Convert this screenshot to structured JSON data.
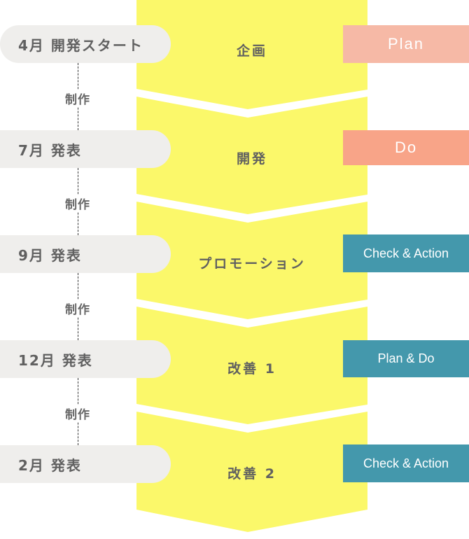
{
  "colors": {
    "column": "#fbf86a",
    "pill": "#efeeec",
    "text": "#606060",
    "plan": "#f6b9a6",
    "do": "#f8a488",
    "teal": "#4498ac"
  },
  "milestones": [
    {
      "month": "4月",
      "label": "開発スタート"
    },
    {
      "month": "7月",
      "label": "発表"
    },
    {
      "month": "9月",
      "label": "発表"
    },
    {
      "month": "12月",
      "label": "発表"
    },
    {
      "month": "2月",
      "label": "発表"
    }
  ],
  "production_label": "制作",
  "stages": [
    {
      "name": "企画",
      "tag": "Plan"
    },
    {
      "name": "開発",
      "tag": "Do"
    },
    {
      "name": "プロモーション",
      "tag": "Check & Action"
    },
    {
      "name": "改善 1",
      "tag": "Plan & Do"
    },
    {
      "name": "改善 2",
      "tag": "Check & Action"
    }
  ]
}
